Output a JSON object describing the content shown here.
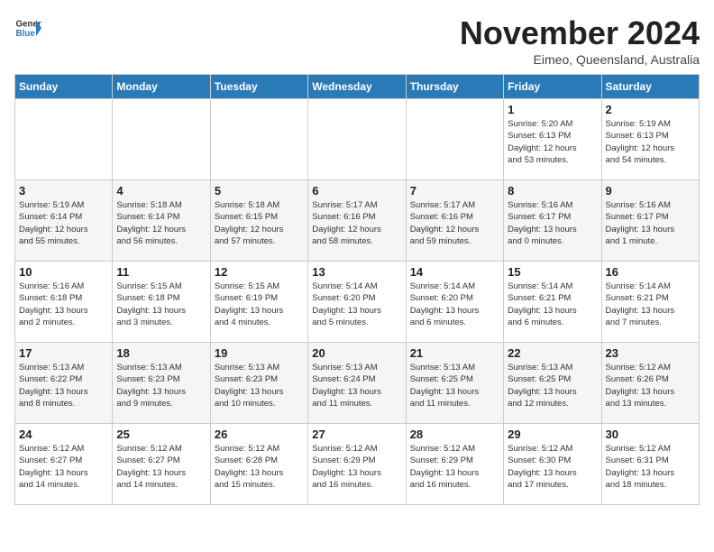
{
  "logo": {
    "general": "General",
    "blue": "Blue"
  },
  "header": {
    "month": "November 2024",
    "location": "Eimeo, Queensland, Australia"
  },
  "days_of_week": [
    "Sunday",
    "Monday",
    "Tuesday",
    "Wednesday",
    "Thursday",
    "Friday",
    "Saturday"
  ],
  "weeks": [
    [
      {
        "day": "",
        "info": ""
      },
      {
        "day": "",
        "info": ""
      },
      {
        "day": "",
        "info": ""
      },
      {
        "day": "",
        "info": ""
      },
      {
        "day": "",
        "info": ""
      },
      {
        "day": "1",
        "info": "Sunrise: 5:20 AM\nSunset: 6:13 PM\nDaylight: 12 hours\nand 53 minutes."
      },
      {
        "day": "2",
        "info": "Sunrise: 5:19 AM\nSunset: 6:13 PM\nDaylight: 12 hours\nand 54 minutes."
      }
    ],
    [
      {
        "day": "3",
        "info": "Sunrise: 5:19 AM\nSunset: 6:14 PM\nDaylight: 12 hours\nand 55 minutes."
      },
      {
        "day": "4",
        "info": "Sunrise: 5:18 AM\nSunset: 6:14 PM\nDaylight: 12 hours\nand 56 minutes."
      },
      {
        "day": "5",
        "info": "Sunrise: 5:18 AM\nSunset: 6:15 PM\nDaylight: 12 hours\nand 57 minutes."
      },
      {
        "day": "6",
        "info": "Sunrise: 5:17 AM\nSunset: 6:16 PM\nDaylight: 12 hours\nand 58 minutes."
      },
      {
        "day": "7",
        "info": "Sunrise: 5:17 AM\nSunset: 6:16 PM\nDaylight: 12 hours\nand 59 minutes."
      },
      {
        "day": "8",
        "info": "Sunrise: 5:16 AM\nSunset: 6:17 PM\nDaylight: 13 hours\nand 0 minutes."
      },
      {
        "day": "9",
        "info": "Sunrise: 5:16 AM\nSunset: 6:17 PM\nDaylight: 13 hours\nand 1 minute."
      }
    ],
    [
      {
        "day": "10",
        "info": "Sunrise: 5:16 AM\nSunset: 6:18 PM\nDaylight: 13 hours\nand 2 minutes."
      },
      {
        "day": "11",
        "info": "Sunrise: 5:15 AM\nSunset: 6:18 PM\nDaylight: 13 hours\nand 3 minutes."
      },
      {
        "day": "12",
        "info": "Sunrise: 5:15 AM\nSunset: 6:19 PM\nDaylight: 13 hours\nand 4 minutes."
      },
      {
        "day": "13",
        "info": "Sunrise: 5:14 AM\nSunset: 6:20 PM\nDaylight: 13 hours\nand 5 minutes."
      },
      {
        "day": "14",
        "info": "Sunrise: 5:14 AM\nSunset: 6:20 PM\nDaylight: 13 hours\nand 6 minutes."
      },
      {
        "day": "15",
        "info": "Sunrise: 5:14 AM\nSunset: 6:21 PM\nDaylight: 13 hours\nand 6 minutes."
      },
      {
        "day": "16",
        "info": "Sunrise: 5:14 AM\nSunset: 6:21 PM\nDaylight: 13 hours\nand 7 minutes."
      }
    ],
    [
      {
        "day": "17",
        "info": "Sunrise: 5:13 AM\nSunset: 6:22 PM\nDaylight: 13 hours\nand 8 minutes."
      },
      {
        "day": "18",
        "info": "Sunrise: 5:13 AM\nSunset: 6:23 PM\nDaylight: 13 hours\nand 9 minutes."
      },
      {
        "day": "19",
        "info": "Sunrise: 5:13 AM\nSunset: 6:23 PM\nDaylight: 13 hours\nand 10 minutes."
      },
      {
        "day": "20",
        "info": "Sunrise: 5:13 AM\nSunset: 6:24 PM\nDaylight: 13 hours\nand 11 minutes."
      },
      {
        "day": "21",
        "info": "Sunrise: 5:13 AM\nSunset: 6:25 PM\nDaylight: 13 hours\nand 11 minutes."
      },
      {
        "day": "22",
        "info": "Sunrise: 5:13 AM\nSunset: 6:25 PM\nDaylight: 13 hours\nand 12 minutes."
      },
      {
        "day": "23",
        "info": "Sunrise: 5:12 AM\nSunset: 6:26 PM\nDaylight: 13 hours\nand 13 minutes."
      }
    ],
    [
      {
        "day": "24",
        "info": "Sunrise: 5:12 AM\nSunset: 6:27 PM\nDaylight: 13 hours\nand 14 minutes."
      },
      {
        "day": "25",
        "info": "Sunrise: 5:12 AM\nSunset: 6:27 PM\nDaylight: 13 hours\nand 14 minutes."
      },
      {
        "day": "26",
        "info": "Sunrise: 5:12 AM\nSunset: 6:28 PM\nDaylight: 13 hours\nand 15 minutes."
      },
      {
        "day": "27",
        "info": "Sunrise: 5:12 AM\nSunset: 6:29 PM\nDaylight: 13 hours\nand 16 minutes."
      },
      {
        "day": "28",
        "info": "Sunrise: 5:12 AM\nSunset: 6:29 PM\nDaylight: 13 hours\nand 16 minutes."
      },
      {
        "day": "29",
        "info": "Sunrise: 5:12 AM\nSunset: 6:30 PM\nDaylight: 13 hours\nand 17 minutes."
      },
      {
        "day": "30",
        "info": "Sunrise: 5:12 AM\nSunset: 6:31 PM\nDaylight: 13 hours\nand 18 minutes."
      }
    ]
  ]
}
